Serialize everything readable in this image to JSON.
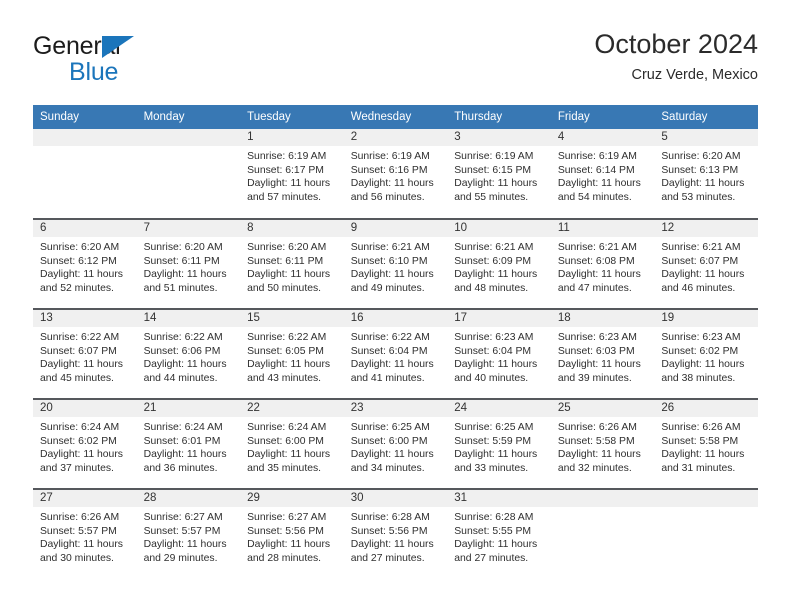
{
  "branding": {
    "logo_line1": "General",
    "logo_line2": "Blue",
    "logo_triangle_icon": "triangle-icon",
    "accent_color": "#1b75bb"
  },
  "header": {
    "title": "October 2024",
    "subtitle": "Cruz Verde, Mexico"
  },
  "theme": {
    "header_row_bg": "#3878b4",
    "header_row_text": "#ffffff",
    "daynum_band_bg": "#f0f0f0",
    "row_divider": "#55585c"
  },
  "weekday_headers": [
    "Sunday",
    "Monday",
    "Tuesday",
    "Wednesday",
    "Thursday",
    "Friday",
    "Saturday"
  ],
  "weeks": [
    [
      {
        "day": "",
        "lines": []
      },
      {
        "day": "",
        "lines": []
      },
      {
        "day": "1",
        "lines": [
          "Sunrise: 6:19 AM",
          "Sunset: 6:17 PM",
          "Daylight: 11 hours",
          "and 57 minutes."
        ]
      },
      {
        "day": "2",
        "lines": [
          "Sunrise: 6:19 AM",
          "Sunset: 6:16 PM",
          "Daylight: 11 hours",
          "and 56 minutes."
        ]
      },
      {
        "day": "3",
        "lines": [
          "Sunrise: 6:19 AM",
          "Sunset: 6:15 PM",
          "Daylight: 11 hours",
          "and 55 minutes."
        ]
      },
      {
        "day": "4",
        "lines": [
          "Sunrise: 6:19 AM",
          "Sunset: 6:14 PM",
          "Daylight: 11 hours",
          "and 54 minutes."
        ]
      },
      {
        "day": "5",
        "lines": [
          "Sunrise: 6:20 AM",
          "Sunset: 6:13 PM",
          "Daylight: 11 hours",
          "and 53 minutes."
        ]
      }
    ],
    [
      {
        "day": "6",
        "lines": [
          "Sunrise: 6:20 AM",
          "Sunset: 6:12 PM",
          "Daylight: 11 hours",
          "and 52 minutes."
        ]
      },
      {
        "day": "7",
        "lines": [
          "Sunrise: 6:20 AM",
          "Sunset: 6:11 PM",
          "Daylight: 11 hours",
          "and 51 minutes."
        ]
      },
      {
        "day": "8",
        "lines": [
          "Sunrise: 6:20 AM",
          "Sunset: 6:11 PM",
          "Daylight: 11 hours",
          "and 50 minutes."
        ]
      },
      {
        "day": "9",
        "lines": [
          "Sunrise: 6:21 AM",
          "Sunset: 6:10 PM",
          "Daylight: 11 hours",
          "and 49 minutes."
        ]
      },
      {
        "day": "10",
        "lines": [
          "Sunrise: 6:21 AM",
          "Sunset: 6:09 PM",
          "Daylight: 11 hours",
          "and 48 minutes."
        ]
      },
      {
        "day": "11",
        "lines": [
          "Sunrise: 6:21 AM",
          "Sunset: 6:08 PM",
          "Daylight: 11 hours",
          "and 47 minutes."
        ]
      },
      {
        "day": "12",
        "lines": [
          "Sunrise: 6:21 AM",
          "Sunset: 6:07 PM",
          "Daylight: 11 hours",
          "and 46 minutes."
        ]
      }
    ],
    [
      {
        "day": "13",
        "lines": [
          "Sunrise: 6:22 AM",
          "Sunset: 6:07 PM",
          "Daylight: 11 hours",
          "and 45 minutes."
        ]
      },
      {
        "day": "14",
        "lines": [
          "Sunrise: 6:22 AM",
          "Sunset: 6:06 PM",
          "Daylight: 11 hours",
          "and 44 minutes."
        ]
      },
      {
        "day": "15",
        "lines": [
          "Sunrise: 6:22 AM",
          "Sunset: 6:05 PM",
          "Daylight: 11 hours",
          "and 43 minutes."
        ]
      },
      {
        "day": "16",
        "lines": [
          "Sunrise: 6:22 AM",
          "Sunset: 6:04 PM",
          "Daylight: 11 hours",
          "and 41 minutes."
        ]
      },
      {
        "day": "17",
        "lines": [
          "Sunrise: 6:23 AM",
          "Sunset: 6:04 PM",
          "Daylight: 11 hours",
          "and 40 minutes."
        ]
      },
      {
        "day": "18",
        "lines": [
          "Sunrise: 6:23 AM",
          "Sunset: 6:03 PM",
          "Daylight: 11 hours",
          "and 39 minutes."
        ]
      },
      {
        "day": "19",
        "lines": [
          "Sunrise: 6:23 AM",
          "Sunset: 6:02 PM",
          "Daylight: 11 hours",
          "and 38 minutes."
        ]
      }
    ],
    [
      {
        "day": "20",
        "lines": [
          "Sunrise: 6:24 AM",
          "Sunset: 6:02 PM",
          "Daylight: 11 hours",
          "and 37 minutes."
        ]
      },
      {
        "day": "21",
        "lines": [
          "Sunrise: 6:24 AM",
          "Sunset: 6:01 PM",
          "Daylight: 11 hours",
          "and 36 minutes."
        ]
      },
      {
        "day": "22",
        "lines": [
          "Sunrise: 6:24 AM",
          "Sunset: 6:00 PM",
          "Daylight: 11 hours",
          "and 35 minutes."
        ]
      },
      {
        "day": "23",
        "lines": [
          "Sunrise: 6:25 AM",
          "Sunset: 6:00 PM",
          "Daylight: 11 hours",
          "and 34 minutes."
        ]
      },
      {
        "day": "24",
        "lines": [
          "Sunrise: 6:25 AM",
          "Sunset: 5:59 PM",
          "Daylight: 11 hours",
          "and 33 minutes."
        ]
      },
      {
        "day": "25",
        "lines": [
          "Sunrise: 6:26 AM",
          "Sunset: 5:58 PM",
          "Daylight: 11 hours",
          "and 32 minutes."
        ]
      },
      {
        "day": "26",
        "lines": [
          "Sunrise: 6:26 AM",
          "Sunset: 5:58 PM",
          "Daylight: 11 hours",
          "and 31 minutes."
        ]
      }
    ],
    [
      {
        "day": "27",
        "lines": [
          "Sunrise: 6:26 AM",
          "Sunset: 5:57 PM",
          "Daylight: 11 hours",
          "and 30 minutes."
        ]
      },
      {
        "day": "28",
        "lines": [
          "Sunrise: 6:27 AM",
          "Sunset: 5:57 PM",
          "Daylight: 11 hours",
          "and 29 minutes."
        ]
      },
      {
        "day": "29",
        "lines": [
          "Sunrise: 6:27 AM",
          "Sunset: 5:56 PM",
          "Daylight: 11 hours",
          "and 28 minutes."
        ]
      },
      {
        "day": "30",
        "lines": [
          "Sunrise: 6:28 AM",
          "Sunset: 5:56 PM",
          "Daylight: 11 hours",
          "and 27 minutes."
        ]
      },
      {
        "day": "31",
        "lines": [
          "Sunrise: 6:28 AM",
          "Sunset: 5:55 PM",
          "Daylight: 11 hours",
          "and 27 minutes."
        ]
      },
      {
        "day": "",
        "lines": []
      },
      {
        "day": "",
        "lines": []
      }
    ]
  ]
}
